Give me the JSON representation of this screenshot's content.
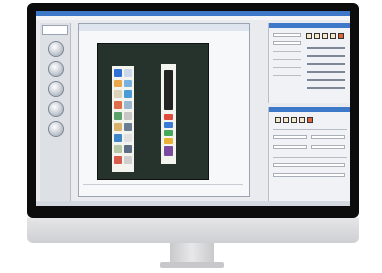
{
  "device": {
    "type": "desktop-monitor"
  },
  "window": {
    "title": "",
    "subtitle": ""
  },
  "tool_rail": {
    "buttons": [
      "tool-1",
      "tool-2",
      "tool-3",
      "tool-4",
      "tool-5"
    ]
  },
  "right_panel": {
    "toolbar_icons": [
      "tool-icon-1",
      "tool-icon-2",
      "tool-icon-3",
      "tool-icon-4",
      "tool-icon-5",
      "tool-icon-6"
    ]
  },
  "bottom_panel": {
    "toolbar_icons": [
      "tool-icon-1",
      "tool-icon-2",
      "tool-icon-3",
      "tool-icon-4",
      "tool-icon-5"
    ]
  },
  "colors": {
    "accent": "#3e78c8",
    "warning": "#e0653a",
    "artboard": "#26332c"
  }
}
